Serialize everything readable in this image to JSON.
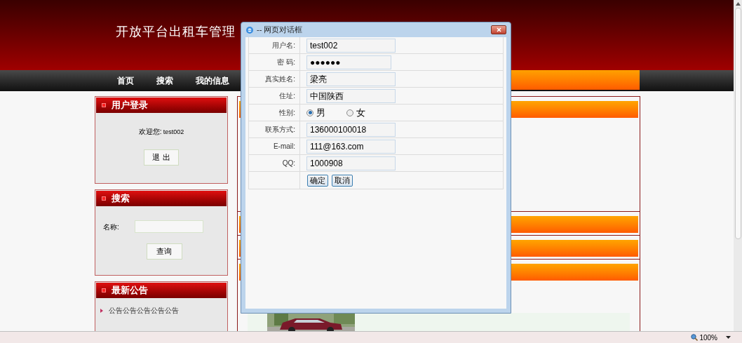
{
  "header": {
    "title": "开放平台出租车管理"
  },
  "nav": [
    {
      "label": "首页"
    },
    {
      "label": "搜索"
    },
    {
      "label": "我的信息"
    }
  ],
  "login_box": {
    "title": "用户登录",
    "welcome": "欢迎您:",
    "username": "test002",
    "logout_button": "退 出"
  },
  "search_box": {
    "title": "搜索",
    "name_label": "名称:",
    "search_button": "查询"
  },
  "notice_box": {
    "title": "最新公告",
    "items": [
      "公告公告公告公告公告"
    ]
  },
  "dialog": {
    "title": "-- 网页对话框",
    "fields": [
      {
        "kind": "text",
        "label": "用户名:",
        "value": "test002"
      },
      {
        "kind": "password",
        "label": "密 码:",
        "value": "●●●●●●"
      },
      {
        "kind": "text",
        "label": "真实姓名:",
        "value": "梁亮"
      },
      {
        "kind": "text",
        "label": "住址:",
        "value": "中国陕西"
      },
      {
        "kind": "radio",
        "label": "性别:",
        "options": [
          {
            "label": "男",
            "selected": true
          },
          {
            "label": "女",
            "selected": false
          }
        ]
      },
      {
        "kind": "text",
        "label": "联系方式:",
        "value": "136000100018"
      },
      {
        "kind": "text",
        "label": "E-mail:",
        "value": "111@163.com"
      },
      {
        "kind": "text",
        "label": "QQ:",
        "value": "1000908"
      }
    ],
    "buttons": [
      "确定",
      "取消"
    ]
  },
  "status_bar": {
    "zoom": "100%"
  }
}
